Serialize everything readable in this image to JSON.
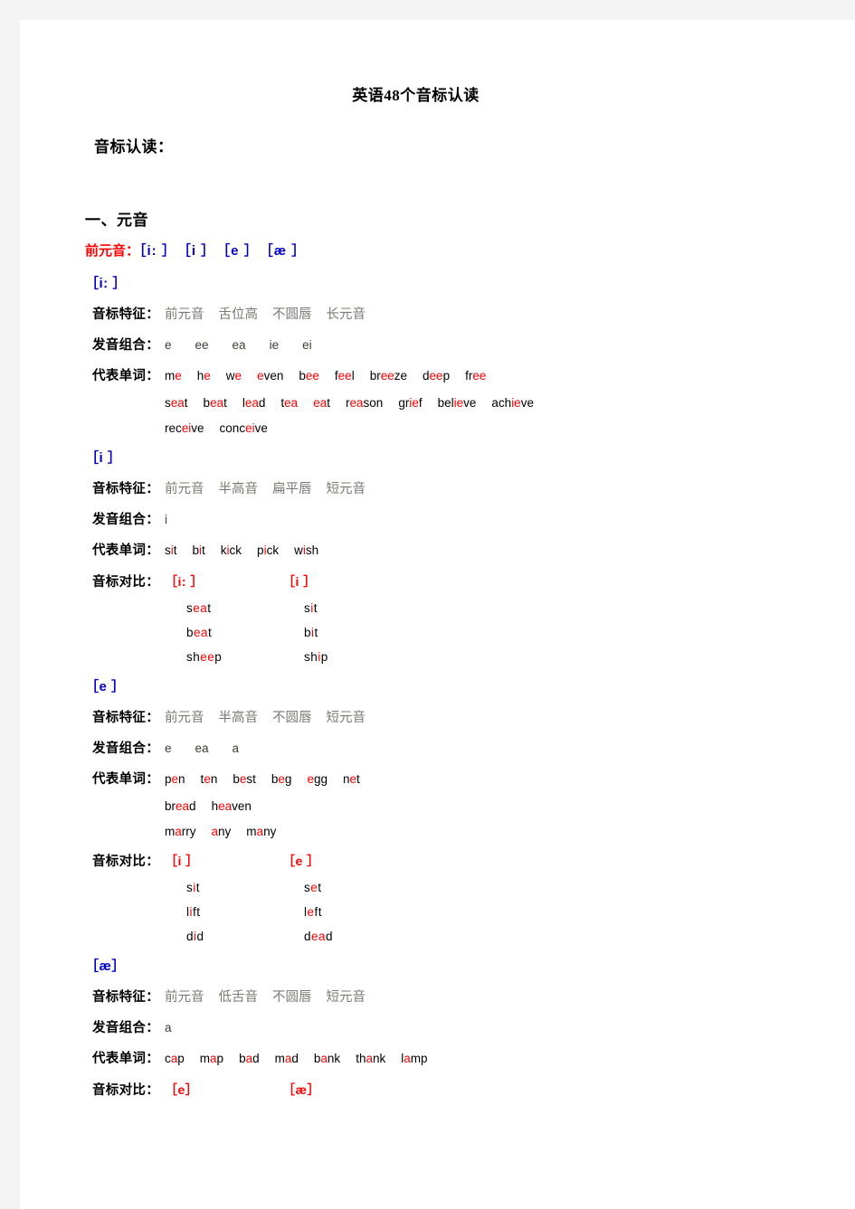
{
  "document": {
    "title": "英语48个音标认读",
    "subtitle": "音标认读：",
    "section_heading": "一、元音",
    "group": {
      "label": "前元音：",
      "symbols": "［i: ］　［i ］　［e ］　［æ ］"
    },
    "labels": {
      "features": "音标特征：",
      "combos": "发音组合：",
      "words": "代表单词：",
      "compare": "音标对比："
    }
  },
  "phonemes": [
    {
      "symbol": "［i: ］",
      "features": [
        "前元音",
        "舌位高",
        "不圆唇",
        "长元音"
      ],
      "combos": [
        "e",
        "ee",
        "ea",
        "ie",
        "ei"
      ],
      "word_lines": [
        [
          {
            "pre": "m",
            "hl": "e",
            "post": ""
          },
          {
            "pre": "h",
            "hl": "e",
            "post": ""
          },
          {
            "pre": "w",
            "hl": "e",
            "post": ""
          },
          {
            "pre": "",
            "hl": "e",
            "post": "ven"
          },
          {
            "pre": "b",
            "hl": "ee",
            "post": ""
          },
          {
            "pre": "f",
            "hl": "ee",
            "post": "l"
          },
          {
            "pre": "br",
            "hl": "ee",
            "post": "ze"
          },
          {
            "pre": "d",
            "hl": "ee",
            "post": "p"
          },
          {
            "pre": "fr",
            "hl": "ee",
            "post": ""
          }
        ],
        [
          {
            "pre": "s",
            "hl": "ea",
            "post": "t"
          },
          {
            "pre": "b",
            "hl": "ea",
            "post": "t"
          },
          {
            "pre": "l",
            "hl": "ea",
            "post": "d"
          },
          {
            "pre": "t",
            "hl": "ea",
            "post": ""
          },
          {
            "pre": "",
            "hl": "ea",
            "post": "t"
          },
          {
            "pre": "r",
            "hl": "ea",
            "post": "son"
          },
          {
            "pre": "gr",
            "hl": "ie",
            "post": "f"
          },
          {
            "pre": "bel",
            "hl": "ie",
            "post": "ve"
          },
          {
            "pre": "ach",
            "hl": "ie",
            "post": "ve"
          }
        ],
        [
          {
            "pre": "rec",
            "hl": "ei",
            "post": "ve"
          },
          {
            "pre": "conc",
            "hl": "ei",
            "post": "ve"
          }
        ]
      ],
      "compare": null
    },
    {
      "symbol": "［i ］",
      "features": [
        "前元音",
        "半高音",
        "扁平唇",
        "短元音"
      ],
      "combos": [
        "i"
      ],
      "word_lines": [
        [
          {
            "pre": "s",
            "hl": "i",
            "post": "t"
          },
          {
            "pre": "b",
            "hl": "i",
            "post": "t"
          },
          {
            "pre": "k",
            "hl": "i",
            "post": "ck"
          },
          {
            "pre": "p",
            "hl": "i",
            "post": "ck"
          },
          {
            "pre": "w",
            "hl": "i",
            "post": "sh"
          }
        ]
      ],
      "compare": {
        "headers": [
          "［i: ］",
          "［i ］"
        ],
        "rows": [
          [
            {
              "pre": "s",
              "hl": "ea",
              "post": "t"
            },
            {
              "pre": "s",
              "hl": "i",
              "post": "t"
            }
          ],
          [
            {
              "pre": "b",
              "hl": "ea",
              "post": "t"
            },
            {
              "pre": "b",
              "hl": "i",
              "post": "t"
            }
          ],
          [
            {
              "pre": "sh",
              "hl": "ee",
              "post": "p"
            },
            {
              "pre": "sh",
              "hl": "i",
              "post": "p"
            }
          ]
        ]
      }
    },
    {
      "symbol": "［e ］",
      "features": [
        "前元音",
        "半高音",
        "不圆唇",
        "短元音"
      ],
      "combos": [
        "e",
        "ea",
        "a"
      ],
      "word_lines": [
        [
          {
            "pre": "p",
            "hl": "e",
            "post": "n"
          },
          {
            "pre": "t",
            "hl": "e",
            "post": "n"
          },
          {
            "pre": "b",
            "hl": "e",
            "post": "st"
          },
          {
            "pre": "b",
            "hl": "e",
            "post": "g"
          },
          {
            "pre": "",
            "hl": "e",
            "post": "gg"
          },
          {
            "pre": "n",
            "hl": "e",
            "post": "t"
          }
        ],
        [
          {
            "pre": "br",
            "hl": "ea",
            "post": "d"
          },
          {
            "pre": "h",
            "hl": "ea",
            "post": "ven"
          }
        ],
        [
          {
            "pre": "m",
            "hl": "a",
            "post": "rry"
          },
          {
            "pre": "",
            "hl": "a",
            "post": "ny"
          },
          {
            "pre": "m",
            "hl": "a",
            "post": "ny"
          }
        ]
      ],
      "compare": {
        "headers": [
          "［i ］",
          "［e ］"
        ],
        "rows": [
          [
            {
              "pre": "s",
              "hl": "i",
              "post": "t"
            },
            {
              "pre": "s",
              "hl": "e",
              "post": "t"
            }
          ],
          [
            {
              "pre": "l",
              "hl": "i",
              "post": "ft"
            },
            {
              "pre": "l",
              "hl": "e",
              "post": "ft"
            }
          ],
          [
            {
              "pre": "d",
              "hl": "i",
              "post": "d"
            },
            {
              "pre": "d",
              "hl": "ea",
              "post": "d"
            }
          ]
        ]
      }
    },
    {
      "symbol": "［æ］",
      "features": [
        "前元音",
        "低舌音",
        "不圆唇",
        "短元音"
      ],
      "combos": [
        "a"
      ],
      "word_lines": [
        [
          {
            "pre": "c",
            "hl": "a",
            "post": "p"
          },
          {
            "pre": "m",
            "hl": "a",
            "post": "p"
          },
          {
            "pre": "b",
            "hl": "a",
            "post": "d"
          },
          {
            "pre": "m",
            "hl": "a",
            "post": "d"
          },
          {
            "pre": "b",
            "hl": "a",
            "post": "nk"
          },
          {
            "pre": "th",
            "hl": "a",
            "post": "nk"
          },
          {
            "pre": "l",
            "hl": "a",
            "post": "mp"
          }
        ]
      ],
      "compare": {
        "headers": [
          "［e］",
          "［æ］"
        ],
        "rows": []
      }
    }
  ],
  "colors": {
    "highlight": "#ff0000",
    "symbol": "#0000cc",
    "feature": "#7a7a72",
    "page_background": "#ffffff",
    "canvas_background": "#f4f4f4"
  }
}
